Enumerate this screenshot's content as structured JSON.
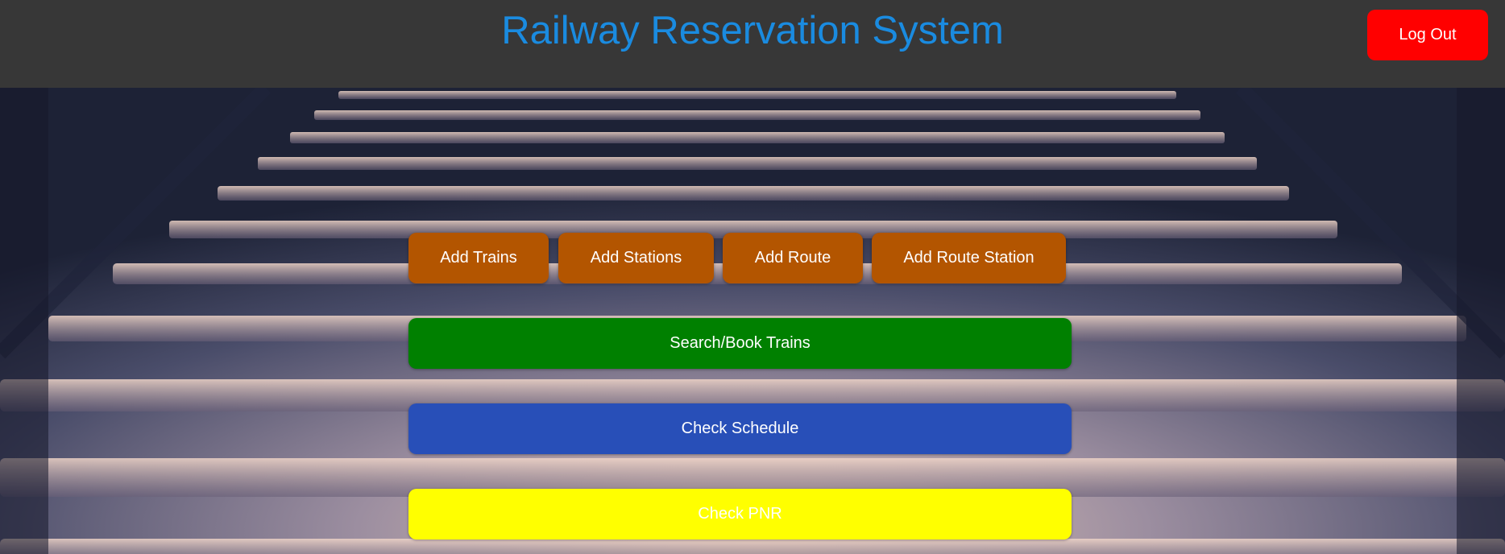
{
  "header": {
    "title": "Railway Reservation System",
    "title_color": "#1a8be0",
    "logout_label": "Log Out",
    "logout_color": "#ff0000"
  },
  "admin_actions": [
    {
      "label": "Add Trains",
      "color": "#b35500"
    },
    {
      "label": "Add Stations",
      "color": "#b35500"
    },
    {
      "label": "Add Route",
      "color": "#b35500"
    },
    {
      "label": "Add Route Station",
      "color": "#b35500"
    }
  ],
  "main_actions": {
    "search": {
      "label": "Search/Book Trains",
      "color": "#008000"
    },
    "schedule": {
      "label": "Check Schedule",
      "color": "#284fb8"
    },
    "pnr": {
      "label": "Check PNR",
      "color": "#ffff00"
    }
  },
  "background": {
    "description_icon": "railway-track-image"
  }
}
